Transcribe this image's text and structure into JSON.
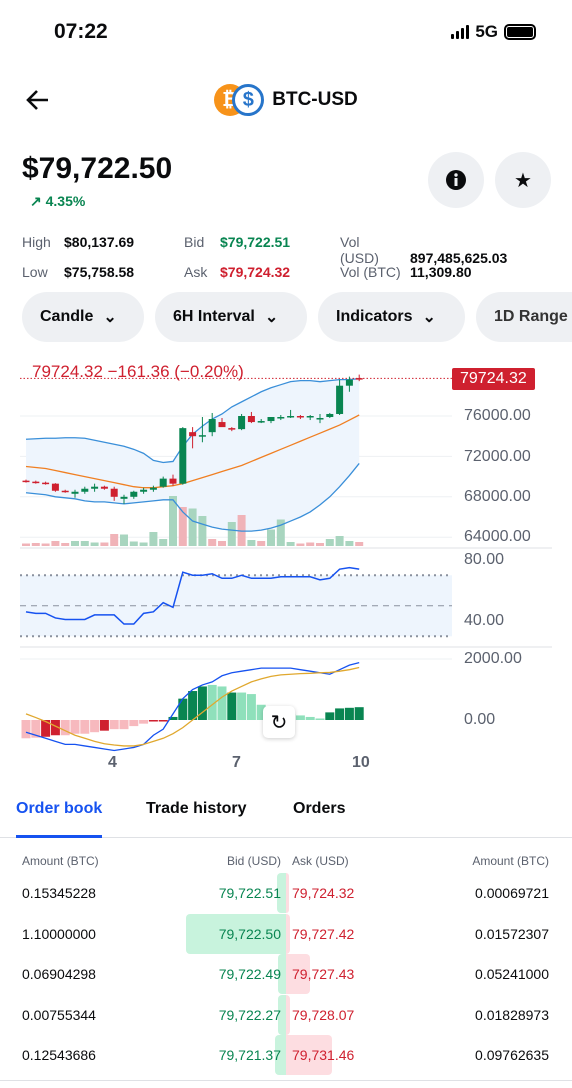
{
  "status_bar": {
    "time": "07:22",
    "network": "5G"
  },
  "header": {
    "title": "BTC-USD",
    "back_icon": "arrow-left-icon",
    "coin_icons": [
      "bitcoin-icon",
      "usd-coin-icon"
    ],
    "colors": {
      "btc": "#f7931a",
      "usd": "#2775ca"
    }
  },
  "price": {
    "value": "$79,722.50",
    "change": "4.35%",
    "change_icon": "arrow-up-right-icon"
  },
  "actions": {
    "info_icon": "info-icon",
    "favorite_icon": "star-icon"
  },
  "stats": [
    {
      "label": "High",
      "value": "$80,137.69"
    },
    {
      "label": "Low",
      "value": "$75,758.58"
    },
    {
      "label": "Bid",
      "value": "$79,722.51"
    },
    {
      "label": "Ask",
      "value": "$79,724.32"
    },
    {
      "label": "Vol (USD)",
      "value": "897,485,625.03"
    },
    {
      "label": "Vol (BTC)",
      "value": "11,309.80"
    }
  ],
  "filters": [
    {
      "label": "Candle"
    },
    {
      "label": "6H Interval"
    },
    {
      "label": "Indicators"
    },
    {
      "label": "1D Range"
    }
  ],
  "chart": {
    "legend": "79724.32  −161.36 (−0.20%)",
    "last_price_tag": "79724.32",
    "price_ticks": [
      "76000.00",
      "72000.00",
      "68000.00",
      "64000.00"
    ],
    "rsi_ticks": [
      "80.00",
      "40.00"
    ],
    "macd_ticks": [
      "2000.00",
      "0.00"
    ],
    "x_ticks": [
      "4",
      "7",
      "10"
    ],
    "reset_icon": "reset-icon"
  },
  "chart_data": {
    "type": "candlestick",
    "price_axis": {
      "ticks": [
        76000,
        72000,
        68000,
        64000
      ]
    },
    "last_price": 79724.32,
    "x_ticks": [
      {
        "label": "4",
        "index": 9.3
      },
      {
        "label": "7",
        "index": 22
      },
      {
        "label": "10",
        "index": 35
      }
    ],
    "colors": {
      "up": "#098551",
      "down": "#cf202f",
      "bb": "#3a8fd9",
      "ma": "#f07f22",
      "rsi": "#1652f0",
      "signal": "#e0a82e"
    },
    "candles": [
      [
        69600,
        69700,
        69400,
        69500
      ],
      [
        69500,
        69600,
        69300,
        69400
      ],
      [
        69400,
        69500,
        69200,
        69300
      ],
      [
        69300,
        69350,
        68500,
        68600
      ],
      [
        68600,
        68700,
        68400,
        68500
      ],
      [
        68300,
        68700,
        67900,
        68500
      ],
      [
        68500,
        69000,
        68300,
        68800
      ],
      [
        68800,
        69300,
        68500,
        69000
      ],
      [
        69000,
        69100,
        68700,
        68800
      ],
      [
        68800,
        69000,
        67600,
        68000
      ],
      [
        67800,
        68200,
        67300,
        68000
      ],
      [
        68000,
        68600,
        67800,
        68500
      ],
      [
        68500,
        68900,
        68300,
        68700
      ],
      [
        68700,
        69100,
        68500,
        68900
      ],
      [
        69000,
        70000,
        68900,
        69800
      ],
      [
        69800,
        70200,
        69100,
        69300
      ],
      [
        69300,
        74900,
        69200,
        74800
      ],
      [
        74400,
        74900,
        72800,
        74000
      ],
      [
        74000,
        75900,
        73400,
        74100
      ],
      [
        74400,
        76300,
        74000,
        75700
      ],
      [
        75400,
        75800,
        75100,
        74900
      ],
      [
        74800,
        74900,
        74500,
        74700
      ],
      [
        74700,
        76200,
        74600,
        76000
      ],
      [
        76000,
        76400,
        75300,
        75400
      ],
      [
        75500,
        75700,
        75300,
        75500
      ],
      [
        75500,
        75900,
        75300,
        75900
      ],
      [
        75900,
        76100,
        75600,
        75900
      ],
      [
        75900,
        76600,
        75800,
        76000
      ],
      [
        76000,
        76100,
        75700,
        75900
      ],
      [
        76000,
        76100,
        75600,
        76000
      ],
      [
        75700,
        76200,
        75300,
        75800
      ],
      [
        75900,
        76300,
        75800,
        76200
      ],
      [
        76200,
        79600,
        76100,
        79000
      ],
      [
        79000,
        79900,
        78400,
        79600
      ],
      [
        79750,
        80100,
        79450,
        79724
      ]
    ],
    "bb_upper": [
      73700,
      73750,
      73800,
      73800,
      73850,
      73850,
      73800,
      73600,
      73400,
      73200,
      73000,
      72700,
      72300,
      71600,
      71400,
      71500,
      73000,
      74200,
      75000,
      75700,
      76200,
      76900,
      77400,
      77900,
      78400,
      78800,
      79100,
      79400,
      79500,
      79500,
      79400,
      79500,
      79600,
      79600,
      79700
    ],
    "bb_middle": [
      71000,
      70900,
      70800,
      70600,
      70400,
      70200,
      70000,
      69800,
      69600,
      69400,
      69200,
      69000,
      68900,
      68900,
      69000,
      69100,
      69300,
      69600,
      69900,
      70200,
      70500,
      70800,
      71100,
      71500,
      71900,
      72300,
      72700,
      73100,
      73500,
      73900,
      74300,
      74700,
      75100,
      75600,
      76100
    ],
    "bb_lower": [
      68400,
      68300,
      68200,
      68000,
      67900,
      67800,
      67600,
      67500,
      67500,
      67400,
      67300,
      67400,
      67500,
      67600,
      67700,
      67700,
      66500,
      65600,
      65300,
      65000,
      64800,
      64700,
      64600,
      64600,
      64700,
      64900,
      65200,
      65600,
      66000,
      66500,
      67200,
      68000,
      69000,
      70100,
      71300
    ],
    "volume": [
      5,
      6,
      5,
      10,
      6,
      10,
      10,
      7,
      7,
      24,
      23,
      9,
      7,
      28,
      14,
      100,
      78,
      75,
      60,
      14,
      10,
      48,
      62,
      12,
      10,
      33,
      53,
      8,
      5,
      7,
      6,
      14,
      20,
      10,
      8
    ],
    "volume_up": [
      false,
      false,
      false,
      false,
      false,
      true,
      true,
      true,
      false,
      false,
      true,
      true,
      true,
      true,
      true,
      true,
      false,
      true,
      true,
      false,
      false,
      true,
      false,
      true,
      false,
      true,
      true,
      true,
      false,
      false,
      false,
      true,
      true,
      true,
      false
    ],
    "rsi": [
      46,
      45,
      45,
      42,
      41,
      41,
      41,
      44,
      44,
      44,
      38,
      38,
      45,
      46,
      52,
      49,
      72,
      70,
      70,
      71,
      68,
      68,
      70,
      68,
      68,
      68,
      69,
      69,
      69,
      69,
      67,
      68,
      74,
      75,
      74
    ],
    "rsi_levels": {
      "upper": 70,
      "middle": 50,
      "lower": 30
    },
    "macd_axis": {
      "ticks": [
        2000,
        0
      ]
    },
    "macd": [
      -400,
      -500,
      -600,
      -700,
      -800,
      -800,
      -850,
      -900,
      -950,
      -1000,
      -950,
      -900,
      -800,
      -500,
      -300,
      200,
      700,
      1000,
      1150,
      1250,
      1450,
      1550,
      1600,
      1650,
      1700,
      1700,
      1700,
      1700,
      1650,
      1600,
      1550,
      1500,
      1650,
      1800,
      1880
    ],
    "signal": [
      200,
      80,
      -50,
      -200,
      -350,
      -500,
      -600,
      -700,
      -780,
      -820,
      -850,
      -850,
      -800,
      -700,
      -600,
      -450,
      -250,
      0,
      250,
      500,
      750,
      950,
      1100,
      1250,
      1350,
      1430,
      1480,
      1500,
      1520,
      1530,
      1550,
      1560,
      1600,
      1650,
      1720
    ],
    "histogram": [
      -600,
      -580,
      -550,
      -500,
      -500,
      -450,
      -450,
      -400,
      -350,
      -300,
      -300,
      -200,
      -120,
      -50,
      -50,
      100,
      700,
      950,
      1100,
      1150,
      1100,
      900,
      900,
      850,
      500,
      400,
      300,
      200,
      150,
      100,
      50,
      250,
      380,
      400,
      420
    ],
    "histogram_strong": [
      false,
      false,
      true,
      true,
      false,
      false,
      false,
      false,
      true,
      false,
      false,
      false,
      false,
      true,
      true,
      true,
      true,
      true,
      true,
      false,
      false,
      true,
      false,
      false,
      false,
      false,
      false,
      false,
      false,
      false,
      false,
      true,
      true,
      true,
      true
    ]
  },
  "tabs": [
    {
      "label": "Order book",
      "active": true
    },
    {
      "label": "Trade history"
    },
    {
      "label": "Orders"
    }
  ],
  "order_book": {
    "headers": {
      "bid_amount": "Amount (BTC)",
      "bid": "Bid (USD)",
      "ask": "Ask (USD)",
      "ask_amount": "Amount (BTC)"
    },
    "rows": [
      {
        "bid_amount": "0.15345228",
        "bid": "79,722.51",
        "ask": "79,724.32",
        "ask_amount": "0.00069721",
        "bid_depth": 0.09,
        "ask_depth": 0.0
      },
      {
        "bid_amount": "1.10000000",
        "bid": "79,722.50",
        "ask": "79,727.42",
        "ask_amount": "0.01572307",
        "bid_depth": 1.0,
        "ask_depth": 0.02
      },
      {
        "bid_amount": "0.06904298",
        "bid": "79,722.49",
        "ask": "79,727.43",
        "ask_amount": "0.05241000",
        "bid_depth": 0.06,
        "ask_depth": 0.12
      },
      {
        "bid_amount": "0.00755344",
        "bid": "79,722.27",
        "ask": "79,728.07",
        "ask_amount": "0.01828973",
        "bid_depth": 0.0,
        "ask_depth": 0.02
      },
      {
        "bid_amount": "0.12543686",
        "bid": "79,721.37",
        "ask": "79,731.46",
        "ask_amount": "0.09762635",
        "bid_depth": 0.11,
        "ask_depth": 0.23
      }
    ]
  }
}
